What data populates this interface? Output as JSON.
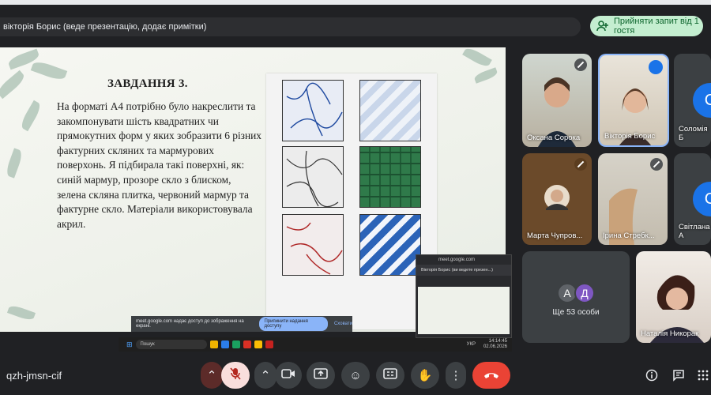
{
  "presenter_bar": {
    "text": "вікторія Борис (веде презентацію, додає примітки)"
  },
  "accept_button": {
    "label": "Прийняти запит від 1 гостя"
  },
  "slide": {
    "title": "ЗАВДАННЯ 3.",
    "body": "На форматі А4 потрібно було накреслити та закомпонувати шість квадратних чи прямокутних форм у яких зобразити 6 різних фактурних скляних та мармурових поверхонь. Я підбирала такі поверхні, як: синій мармур, прозоре скло з блиском, зелена скляна плитка, червоний мармур та фактурне скло. Матеріали використовувала акрил."
  },
  "share_banner": {
    "text": "meet.google.com надає доступ до зображення на екрані.",
    "stop_label": "Припинити надання доступу",
    "hide_label": "Сховати"
  },
  "taskbar": {
    "search": "Пошук",
    "lang": "УКР",
    "time": "14:14:45",
    "date": "02.06.2026"
  },
  "mini_window": {
    "url": "meet.google.com",
    "who": "Вікторія Борис (ви ведете презен...)"
  },
  "participants": [
    {
      "name": "Оксана Сорока",
      "muted": true
    },
    {
      "name": "Вікторія Борис",
      "muted": false
    },
    {
      "name": "Соломія Б",
      "initial": "С",
      "muted": false
    },
    {
      "name": "Марта Чупров...",
      "muted": true
    },
    {
      "name": "Ірина Стребк...",
      "muted": true
    },
    {
      "name": "Світлана А",
      "initial": "С",
      "muted": false
    },
    {
      "name": "Наталія Никорак",
      "muted": false
    }
  ],
  "others": {
    "label": "Ще 53 особи",
    "avatars": [
      "А",
      "Д"
    ]
  },
  "bottom_bar": {
    "meeting_code": "qzh-jmsn-cif"
  },
  "colors": {
    "accent": "#1a73e8",
    "end_call": "#ea4335",
    "accept_bg": "#c4eed0",
    "bar_bg": "#202124"
  }
}
